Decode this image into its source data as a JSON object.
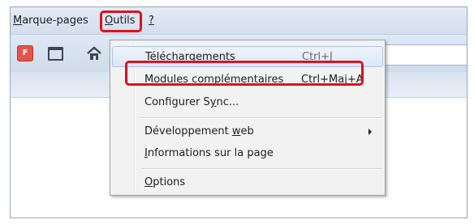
{
  "menubar": {
    "items": [
      {
        "pre": "",
        "u": "M",
        "post": "arque-pages"
      },
      {
        "pre": "",
        "u": "O",
        "post": "utils"
      },
      {
        "pre": "",
        "u": "?",
        "post": ""
      }
    ]
  },
  "toolbar": {
    "flash_icon_text": "F",
    "icons": [
      "flash-icon",
      "window-icon",
      "home-icon"
    ]
  },
  "tools_menu": {
    "items": [
      {
        "pre": "",
        "u": "T",
        "post": "éléchargements",
        "shortcut": "Ctrl+J"
      },
      {
        "pre": "Modu",
        "u": "l",
        "post": "es complémentaires",
        "shortcut": "Ctrl+Maj+A"
      },
      {
        "pre": "Configurer S",
        "u": "y",
        "post": "nc..."
      },
      {
        "pre": "Développement ",
        "u": "w",
        "post": "eb",
        "submenu": true
      },
      {
        "pre": "",
        "u": "I",
        "post": "nformations sur la page"
      },
      {
        "pre": "",
        "u": "O",
        "post": "ptions"
      }
    ]
  },
  "colors": {
    "highlight": "#e0101a",
    "menubar_bg": "#dde6f3",
    "dropdown_bg": "#f2f2f2"
  }
}
